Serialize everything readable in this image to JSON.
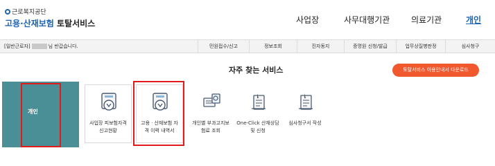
{
  "logo": {
    "org": "근로복지공단",
    "title_blue": "고용·산재보험",
    "title_dark": " 토탈서비스"
  },
  "topnav": {
    "items": [
      "사업장",
      "사무대행기관",
      "의료기관",
      "개인"
    ],
    "active": "개인"
  },
  "subbar": {
    "greeting_prefix": "[일반근로자]",
    "greeting_suffix": "님 반갑습니다.",
    "items": [
      "민원접수/신고",
      "정보조회",
      "진자동지",
      "증명원 신청/발급",
      "업무상질병판정",
      "심사청구"
    ]
  },
  "section": {
    "title": "자주 찾는 서비스"
  },
  "download_button": "토탈서비스 이용안내서 다운로드",
  "left_panel": {
    "label": "개인"
  },
  "services": [
    {
      "line1": "사업장 피보험자격",
      "line2": "신고현황",
      "icon": "folder-download-icon"
    },
    {
      "line1": "고용ㆍ산재보험 자",
      "line2": "격 이력 내역서",
      "icon": "folder-download-icon"
    },
    {
      "line1": "개인별 부과고지보",
      "line2": "험료 조회",
      "icon": "bill-search-icon"
    },
    {
      "line1": "One-Click 산재상담",
      "line2": "및 신청",
      "icon": "document-pen-icon"
    },
    {
      "line1": "심사청구서 작성",
      "line2": "",
      "icon": "document-pen-icon"
    }
  ]
}
